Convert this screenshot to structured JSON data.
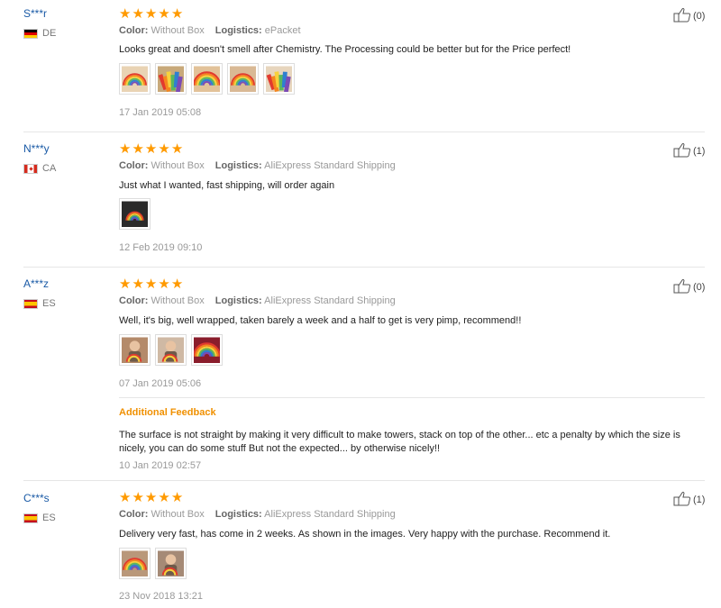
{
  "reviews": [
    {
      "user": "S***r",
      "country_code": "DE",
      "country_label": "DE",
      "rating": 5,
      "color_label": "Color:",
      "color_value": "Without Box",
      "logistics_label": "Logistics:",
      "logistics_value": "ePacket",
      "text": "Looks great and doesn't smell after Chemistry. The Processing could be better but for the Price perfect!",
      "photos": [
        "photo-rainbow-stacker-1",
        "photo-rainbow-stacker-2",
        "photo-rainbow-stacker-3",
        "photo-rainbow-stacker-4",
        "photo-rainbow-stacker-5"
      ],
      "date": "17 Jan 2019 05:08",
      "helpful": "(0)"
    },
    {
      "user": "N***y",
      "country_code": "CA",
      "country_label": "CA",
      "rating": 5,
      "color_label": "Color:",
      "color_value": "Without Box",
      "logistics_label": "Logistics:",
      "logistics_value": "AliExpress Standard Shipping",
      "text": "Just what I wanted, fast shipping, will order again",
      "photos": [
        "photo-rainbow-stacker-dark"
      ],
      "date": "12 Feb 2019 09:10",
      "helpful": "(1)"
    },
    {
      "user": "A***z",
      "country_code": "ES",
      "country_label": "ES",
      "rating": 5,
      "color_label": "Color:",
      "color_value": "Without Box",
      "logistics_label": "Logistics:",
      "logistics_value": "AliExpress Standard Shipping",
      "text": "Well, it's big, well wrapped, taken barely a week and a half to get is very pimp, recommend!!",
      "photos": [
        "photo-child-1",
        "photo-child-2",
        "photo-rainbow-stacker-6"
      ],
      "date": "07 Jan 2019 05:06",
      "helpful": "(0)",
      "additional": {
        "title": "Additional Feedback",
        "text": "The surface is not straight by making it very difficult to make towers, stack on top of the other... etc a penalty by which the size is nicely, you can do some stuff But not the expected... by otherwise nicely!!",
        "date": "10 Jan 2019 02:57"
      }
    },
    {
      "user": "C***s",
      "country_code": "ES",
      "country_label": "ES",
      "rating": 5,
      "color_label": "Color:",
      "color_value": "Without Box",
      "logistics_label": "Logistics:",
      "logistics_value": "AliExpress Standard Shipping",
      "text": "Delivery very fast, has come in 2 weeks. As shown in the images. Very happy with the purchase. Recommend it.",
      "photos": [
        "photo-rainbow-stacker-7",
        "photo-rainbow-stacker-8"
      ],
      "date": "23 Nov 2018 13:21",
      "helpful": "(1)"
    }
  ],
  "colors": {
    "star": "#ff9a00",
    "username": "#1a5aa6",
    "additional_title": "#f09000",
    "muted": "#999999"
  },
  "icons": {
    "star": "star-icon",
    "helpful": "thumbs-up-icon"
  }
}
